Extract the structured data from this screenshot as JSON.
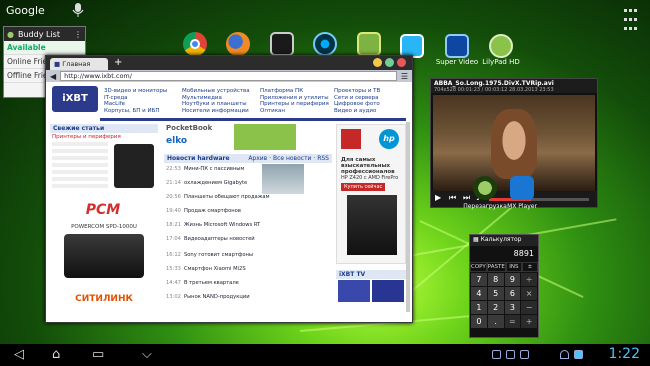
{
  "top": {
    "search_label": "Google",
    "apps_icon": "apps-grid-icon"
  },
  "buddy_list": {
    "title": "Buddy List",
    "statuses": [
      "Available",
      "Online Frie",
      "Offline Frie"
    ]
  },
  "dock": [
    {
      "name": "chrome",
      "label": ""
    },
    {
      "name": "firefox",
      "label": ""
    },
    {
      "name": "app-dark",
      "label": ""
    },
    {
      "name": "speedometer",
      "label": ""
    },
    {
      "name": "tv-green",
      "label": ""
    },
    {
      "name": "tv",
      "label": ""
    },
    {
      "name": "super-video",
      "label": "Super Video"
    },
    {
      "name": "lilypad-hd",
      "label": "LilyPad HD"
    }
  ],
  "browser": {
    "tab_title": "Главная",
    "url": "http://www.ixbt.com/",
    "site_logo": "iXBT",
    "nav": [
      [
        "3D-видео и мониторы",
        "IT-среда",
        "MacLife",
        "Корпусы, БП и ИБП"
      ],
      [
        "Мобильные устройства",
        "Мультимедиа",
        "Ноутбуки и планшеты",
        "Носители информации"
      ],
      [
        "Платформа ПК",
        "Приложения и утилиты",
        "Принтеры и периферия",
        "Оптикан"
      ],
      [
        "Проекторы и ТВ",
        "Сети и сервера",
        "Цифровое фото",
        "Видео и аудио"
      ]
    ],
    "sidebox_title": "Свежие статьи",
    "sidebox_item": "Принтеры и периферия",
    "news_title": "Новости hardware",
    "news_links": [
      "Архив",
      "Все новости",
      "RSS"
    ],
    "news": [
      {
        "time": "22:53",
        "text": "Мини-ПК с пассивным"
      },
      {
        "time": "21:14",
        "text": "охлаждением Gigabyte"
      },
      {
        "time": "20:56",
        "text": "Планшеты обещают продажам"
      },
      {
        "time": "19:40",
        "text": "Продаж смартфонов"
      },
      {
        "time": "18:21",
        "text": "Жизнь Microsoft Windows RT"
      },
      {
        "time": "17:04",
        "text": "Видеоадаптеры новостей"
      },
      {
        "time": "16:12",
        "text": "Sony готовит смартфоны"
      },
      {
        "time": "15:33",
        "text": "Смартфон Xiaomi Mi2S"
      },
      {
        "time": "14:47",
        "text": "В третьем квартале"
      },
      {
        "time": "13:02",
        "text": "Рынок NAND-продукции"
      }
    ],
    "ad_pocketbook": "PocketBook",
    "ad_elko": "elko",
    "ad_hp_text": "Для самых взыскательных профессионалов",
    "ad_hp_model": "HP Z420 с AMD FirePro",
    "ad_buy": "Купить сейчас",
    "ad_pcm": "PCM",
    "ad_pcm_text": "POWERCOM SPD-1000U",
    "ad_citilink": "СИТИЛИНК",
    "ixbt_tv": "iXBT TV"
  },
  "video_player": {
    "title": "ABBA_So.Long.1975.DivX.TVRip.avi",
    "info": "704x528  00:01:23 / 00:03:12  28.03.2013 23:53",
    "progress": 0.42
  },
  "desktop_icons": [
    {
      "name": "vpn-shield",
      "label": "Перезагрузка"
    },
    {
      "name": "mx-player",
      "label": "MX Player"
    }
  ],
  "calculator": {
    "title": "Калькулятор",
    "display": "8891",
    "modes": [
      "COPY",
      "PASTE",
      "INS",
      "±"
    ],
    "keys": [
      "7",
      "8",
      "9",
      "÷",
      "4",
      "5",
      "6",
      "×",
      "1",
      "2",
      "3",
      "−",
      "0",
      ".",
      "=",
      "+"
    ]
  },
  "statusbar": {
    "time": "1:22"
  }
}
